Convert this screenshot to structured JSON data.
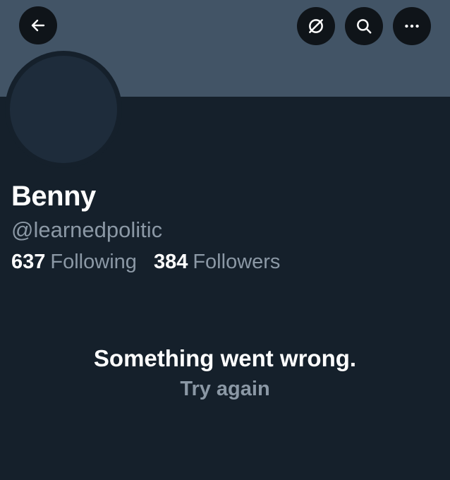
{
  "header": {
    "icons": {
      "back": "arrow-left-icon",
      "grok": "grok-icon",
      "search": "search-icon",
      "more": "more-horizontal-icon"
    },
    "banner_color": "#425466"
  },
  "profile": {
    "display_name": "Benny",
    "handle": "@learnedpolitic",
    "following_count": "637",
    "following_label": "Following",
    "followers_count": "384",
    "followers_label": "Followers"
  },
  "error": {
    "message": "Something went wrong.",
    "retry_label": "Try again"
  },
  "colors": {
    "background": "#15202b",
    "secondary_text": "#8b98a5",
    "primary_text": "#ffffff"
  }
}
